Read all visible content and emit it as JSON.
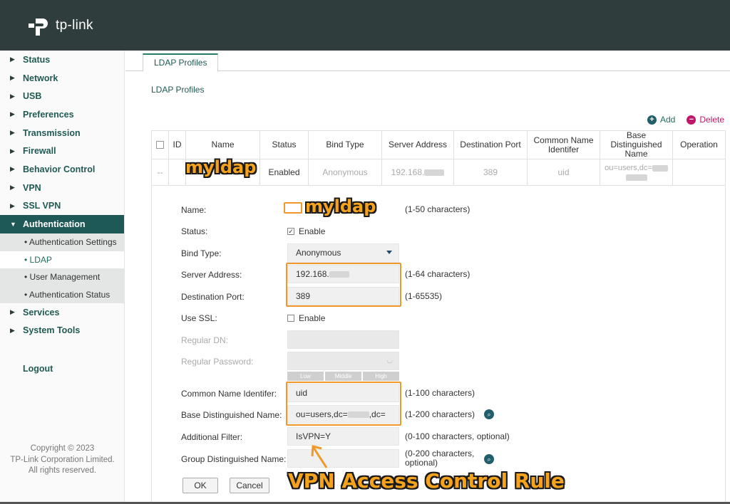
{
  "brand": {
    "name": "tp-link"
  },
  "sidebar": {
    "items": [
      {
        "label": "Status"
      },
      {
        "label": "Network"
      },
      {
        "label": "USB"
      },
      {
        "label": "Preferences"
      },
      {
        "label": "Transmission"
      },
      {
        "label": "Firewall"
      },
      {
        "label": "Behavior Control"
      },
      {
        "label": "VPN"
      },
      {
        "label": "SSL VPN"
      },
      {
        "label": "Authentication"
      },
      {
        "label": "Services"
      },
      {
        "label": "System Tools"
      }
    ],
    "subitems": [
      {
        "label": "• Authentication Settings"
      },
      {
        "label": "• LDAP"
      },
      {
        "label": "• User Management"
      },
      {
        "label": "• Authentication Status"
      }
    ],
    "logout": "Logout",
    "copyright": [
      "Copyright © 2023",
      "TP-Link Corporation Limited.",
      "All rights reserved."
    ]
  },
  "main": {
    "tab": "LDAP Profiles",
    "section_title": "LDAP Profiles",
    "add_label": "Add",
    "delete_label": "Delete",
    "table": {
      "headers": [
        "ID",
        "Name",
        "Status",
        "Bind Type",
        "Server Address",
        "Destination Port",
        "Common Name Identifer",
        "Base Distinguished Name",
        "Operation"
      ],
      "row": {
        "sel": "--",
        "id": "",
        "name": "",
        "status": "Enabled",
        "bind_type": "Anonymous",
        "server_address": "192.168.",
        "port": "389",
        "common_name": "uid",
        "base_dn": "ou=users,dc="
      }
    },
    "form": {
      "name_label": "Name:",
      "name_hint": "(1-50 characters)",
      "status_label": "Status:",
      "status_enable": "Enable",
      "bind_type_label": "Bind Type:",
      "bind_type_value": "Anonymous",
      "server_label": "Server Address:",
      "server_value": "192.168.",
      "server_hint": "(1-64 characters)",
      "port_label": "Destination Port:",
      "port_value": "389",
      "port_hint": "(1-65535)",
      "ssl_label": "Use SSL:",
      "ssl_enable": "Enable",
      "regular_dn_label": "Regular DN:",
      "regular_pw_label": "Regular Password:",
      "strength": [
        "Low",
        "Middle",
        "High"
      ],
      "cn_label": "Common Name Identifer:",
      "cn_value": "uid",
      "cn_hint": "(1-100 characters)",
      "base_dn_label": "Base Distinguished Name:",
      "base_dn_value": "ou=users,dc=",
      "base_dn_value2": ",dc=",
      "base_dn_hint": "(1-200 characters)",
      "filter_label": "Additional Filter:",
      "filter_value": "IsVPN=Y",
      "filter_hint": "(0-100 characters, optional)",
      "group_dn_label": "Group Distinguished Name:",
      "group_dn_hint_1": "(0-200 characters,",
      "group_dn_hint_2": "optional)",
      "ok": "OK",
      "cancel": "Cancel"
    }
  },
  "annotations": {
    "table_name": "myldap",
    "form_name": "myldap",
    "caption": "VPN Access Control Rule"
  },
  "colors": {
    "accent": "#1f5957",
    "annotation": "#f0992a"
  }
}
